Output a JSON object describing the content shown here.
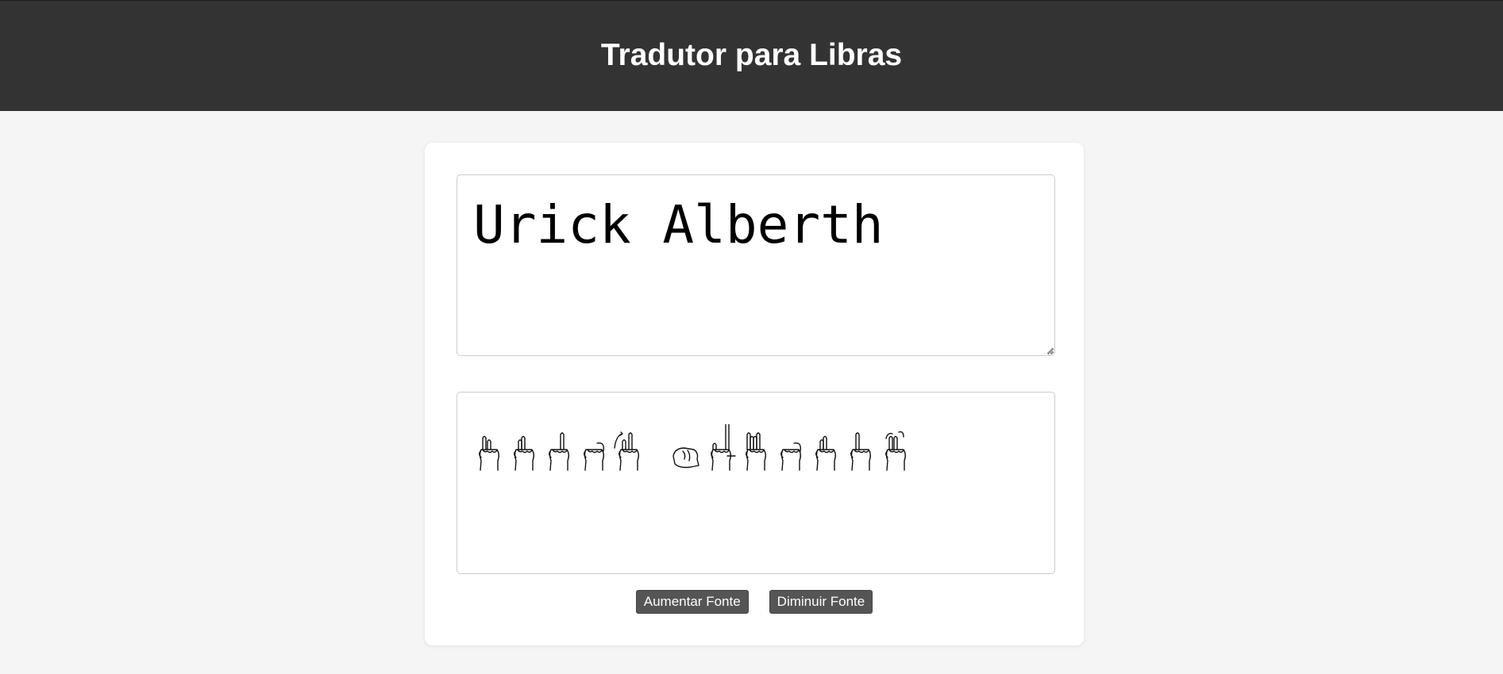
{
  "header": {
    "title": "Tradutor para Libras"
  },
  "translator": {
    "input_text": "Urick Alberth",
    "output_signs": [
      {
        "letter": "U",
        "icon": "libras-hand-u-icon"
      },
      {
        "letter": "r",
        "icon": "libras-hand-r-icon"
      },
      {
        "letter": "i",
        "icon": "libras-hand-i-icon"
      },
      {
        "letter": "c",
        "icon": "libras-hand-c-icon"
      },
      {
        "letter": "k",
        "icon": "libras-hand-k-icon"
      },
      {
        "letter": " ",
        "icon": "space"
      },
      {
        "letter": "A",
        "icon": "libras-hand-a-icon"
      },
      {
        "letter": "l",
        "icon": "libras-hand-l-icon"
      },
      {
        "letter": "b",
        "icon": "libras-hand-b-icon"
      },
      {
        "letter": "e",
        "icon": "libras-hand-e-icon"
      },
      {
        "letter": "r",
        "icon": "libras-hand-r-icon"
      },
      {
        "letter": "t",
        "icon": "libras-hand-t-icon"
      },
      {
        "letter": "h",
        "icon": "libras-hand-h-icon"
      }
    ]
  },
  "controls": {
    "increase_font_label": "Aumentar Fonte",
    "decrease_font_label": "Diminuir Fonte"
  },
  "colors": {
    "header_bg": "#333333",
    "page_bg": "#f5f5f5",
    "button_bg": "#555555"
  }
}
